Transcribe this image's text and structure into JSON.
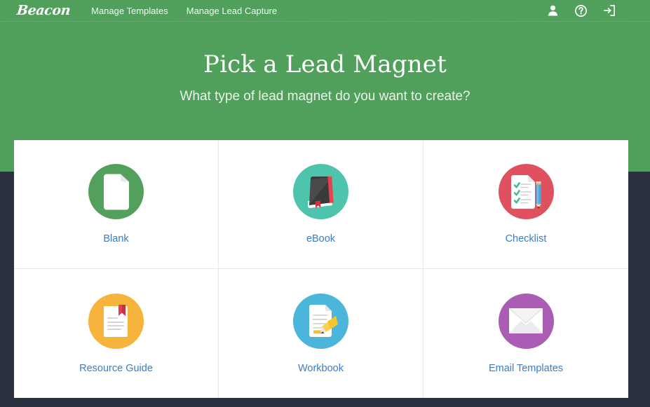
{
  "navbar": {
    "brand": "Beacon",
    "links": [
      {
        "label": "Manage Templates",
        "name": "nav-link-manage-templates"
      },
      {
        "label": "Manage Lead Capture",
        "name": "nav-link-manage-lead-capture"
      }
    ],
    "icons": [
      {
        "name": "user-icon",
        "title": "Account"
      },
      {
        "name": "help-icon",
        "title": "Help"
      },
      {
        "name": "logout-icon",
        "title": "Log out"
      }
    ]
  },
  "hero": {
    "title": "Pick a Lead Magnet",
    "subtitle": "What type of lead magnet do you want to create?"
  },
  "tiles": [
    {
      "label": "Blank",
      "icon": "blank-document-icon",
      "circle_color": "#53a05c"
    },
    {
      "label": "eBook",
      "icon": "book-icon",
      "circle_color": "#4ec4ac"
    },
    {
      "label": "Checklist",
      "icon": "checklist-icon",
      "circle_color": "#e0515f"
    },
    {
      "label": "Resource Guide",
      "icon": "bookmarked-page-icon",
      "circle_color": "#f6b43c"
    },
    {
      "label": "Workbook",
      "icon": "highlighter-icon",
      "circle_color": "#4cb6da"
    },
    {
      "label": "Email Templates",
      "icon": "envelope-icon",
      "circle_color": "#ab5cb4"
    }
  ],
  "colors": {
    "header_green": "#50a05c",
    "page_background": "#2b303e",
    "card_background": "#ffffff",
    "label_blue": "#3b7dc4",
    "divider": "#e9e9ec"
  }
}
